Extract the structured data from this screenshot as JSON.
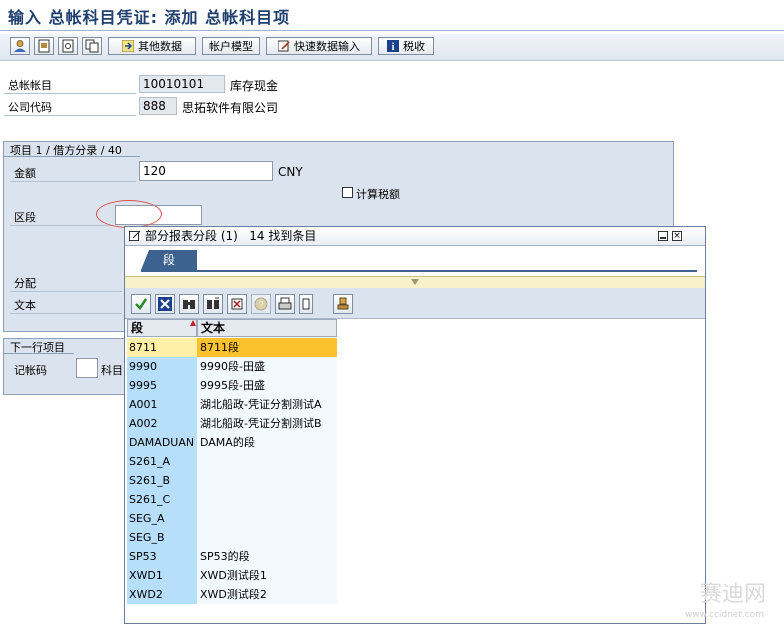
{
  "title": "输入 总帐科目凭证: 添加 总帐科目项",
  "toolbar": {
    "other_data": "其他数据",
    "account_model": "帐户模型",
    "fast_entry": "快速数据输入",
    "tax": "税收"
  },
  "header": {
    "gl_label": "总帐帐目",
    "gl_value": "10010101",
    "gl_desc": "库存现金",
    "company_label": "公司代码",
    "company_value": "888",
    "company_desc": "思拓软件有限公司"
  },
  "item_group": {
    "title": "项目 1 / 借方分录 / 40",
    "amount_label": "金额",
    "amount_value": "120",
    "currency": "CNY",
    "calc_tax_label": "计算税额",
    "segment_label": "区段",
    "segment_value": "",
    "assignment_label": "分配",
    "text_label": "文本"
  },
  "next_group": {
    "title": "下一行项目",
    "posting_key_label": "记帐码",
    "posting_key_value": "",
    "account_label": "科目"
  },
  "popup": {
    "title": "部分报表分段 (1)   14 找到条目",
    "tab_label": "段",
    "columns": [
      "段",
      "文本"
    ],
    "rows": [
      {
        "segment": "8711",
        "text": "8711段"
      },
      {
        "segment": "9990",
        "text": "9990段-田盛"
      },
      {
        "segment": "9995",
        "text": "9995段-田盛"
      },
      {
        "segment": "A001",
        "text": "湖北船政-凭证分割测试A"
      },
      {
        "segment": "A002",
        "text": "湖北船政-凭证分割测试B"
      },
      {
        "segment": "DAMADUAN",
        "text": "DAMA的段"
      },
      {
        "segment": "S261_A",
        "text": ""
      },
      {
        "segment": "S261_B",
        "text": ""
      },
      {
        "segment": "S261_C",
        "text": ""
      },
      {
        "segment": "SEG_A",
        "text": ""
      },
      {
        "segment": "SEG_B",
        "text": ""
      },
      {
        "segment": "SP53",
        "text": "SP53的段"
      },
      {
        "segment": "XWD1",
        "text": "XWD测试段1"
      },
      {
        "segment": "XWD2",
        "text": "XWD测试段2"
      }
    ]
  },
  "watermark": {
    "text": "赛迪网",
    "url": "www.ccidnet.com"
  }
}
